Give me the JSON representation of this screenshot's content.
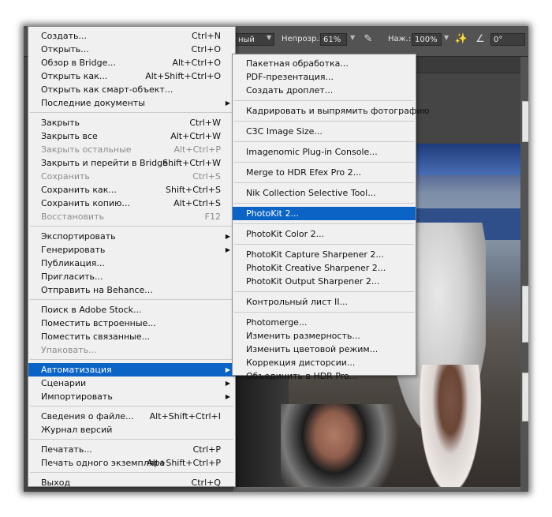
{
  "options_bar": {
    "blend_mode": "ный",
    "opacity_label": "Непрозр.:",
    "opacity_value": "61%",
    "pressure_label": "Наж.:",
    "pressure_value": "100%",
    "angle_value": "0°",
    "icons": [
      "pressure-opacity-icon",
      "airbrush-icon",
      "angle-icon"
    ]
  },
  "file_menu": {
    "groups": [
      [
        {
          "label": "Создать...",
          "shortcut": "Ctrl+N"
        },
        {
          "label": "Открыть...",
          "shortcut": "Ctrl+O"
        },
        {
          "label": "Обзор в Bridge...",
          "shortcut": "Alt+Ctrl+O"
        },
        {
          "label": "Открыть как...",
          "shortcut": "Alt+Shift+Ctrl+O"
        },
        {
          "label": "Открыть как смарт-объект..."
        },
        {
          "label": "Последние документы",
          "submenu": true
        }
      ],
      [
        {
          "label": "Закрыть",
          "shortcut": "Ctrl+W"
        },
        {
          "label": "Закрыть все",
          "shortcut": "Alt+Ctrl+W"
        },
        {
          "label": "Закрыть остальные",
          "shortcut": "Alt+Ctrl+P",
          "disabled": true
        },
        {
          "label": "Закрыть и перейти в Bridge...",
          "shortcut": "Shift+Ctrl+W"
        },
        {
          "label": "Сохранить",
          "shortcut": "Ctrl+S",
          "disabled": true
        },
        {
          "label": "Сохранить как...",
          "shortcut": "Shift+Ctrl+S"
        },
        {
          "label": "Сохранить копию...",
          "shortcut": "Alt+Ctrl+S"
        },
        {
          "label": "Восстановить",
          "shortcut": "F12",
          "disabled": true
        }
      ],
      [
        {
          "label": "Экспортировать",
          "submenu": true
        },
        {
          "label": "Генерировать",
          "submenu": true
        },
        {
          "label": "Публикация..."
        },
        {
          "label": "Пригласить..."
        },
        {
          "label": "Отправить на Behance..."
        }
      ],
      [
        {
          "label": "Поиск в Adobe Stock..."
        },
        {
          "label": "Поместить встроенные..."
        },
        {
          "label": "Поместить связанные..."
        },
        {
          "label": "Упаковать...",
          "disabled": true
        }
      ],
      [
        {
          "label": "Автоматизация",
          "submenu": true,
          "selected": true
        },
        {
          "label": "Сценарии",
          "submenu": true
        },
        {
          "label": "Импортировать",
          "submenu": true
        }
      ],
      [
        {
          "label": "Сведения о файле...",
          "shortcut": "Alt+Shift+Ctrl+I"
        },
        {
          "label": "Журнал версий"
        }
      ],
      [
        {
          "label": "Печатать...",
          "shortcut": "Ctrl+P"
        },
        {
          "label": "Печать одного экземпляра",
          "shortcut": "Alt+Shift+Ctrl+P"
        }
      ],
      [
        {
          "label": "Выход",
          "shortcut": "Ctrl+Q"
        }
      ]
    ]
  },
  "automate_submenu": {
    "groups": [
      [
        {
          "label": "Пакетная обработка..."
        },
        {
          "label": "PDF-презентация..."
        },
        {
          "label": "Создать дроплет..."
        }
      ],
      [
        {
          "label": "Кадрировать и выпрямить фотографию"
        }
      ],
      [
        {
          "label": "C3C Image Size..."
        }
      ],
      [
        {
          "label": "Imagenomic Plug-in Console..."
        }
      ],
      [
        {
          "label": "Merge to HDR Efex Pro 2..."
        }
      ],
      [
        {
          "label": "Nik Collection Selective Tool..."
        }
      ],
      [
        {
          "label": "PhotoKit 2...",
          "selected": true
        }
      ],
      [
        {
          "label": "PhotoKit Color 2..."
        }
      ],
      [
        {
          "label": "PhotoKit Capture Sharpener 2..."
        },
        {
          "label": "PhotoKit Creative Sharpener 2..."
        },
        {
          "label": "PhotoKit Output Sharpener 2..."
        }
      ],
      [
        {
          "label": "Контрольный лист II..."
        }
      ],
      [
        {
          "label": "Photomerge..."
        },
        {
          "label": "Изменить размерность..."
        },
        {
          "label": "Изменить цветовой режим..."
        },
        {
          "label": "Коррекция дисторсии..."
        },
        {
          "label": "Объединить в HDR Pro..."
        }
      ]
    ]
  },
  "colors": {
    "menu_bg": "#f0f0f0",
    "highlight": "#0b64c5",
    "disabled_text": "#8c8c8c",
    "toolbar_bg": "#535353"
  }
}
